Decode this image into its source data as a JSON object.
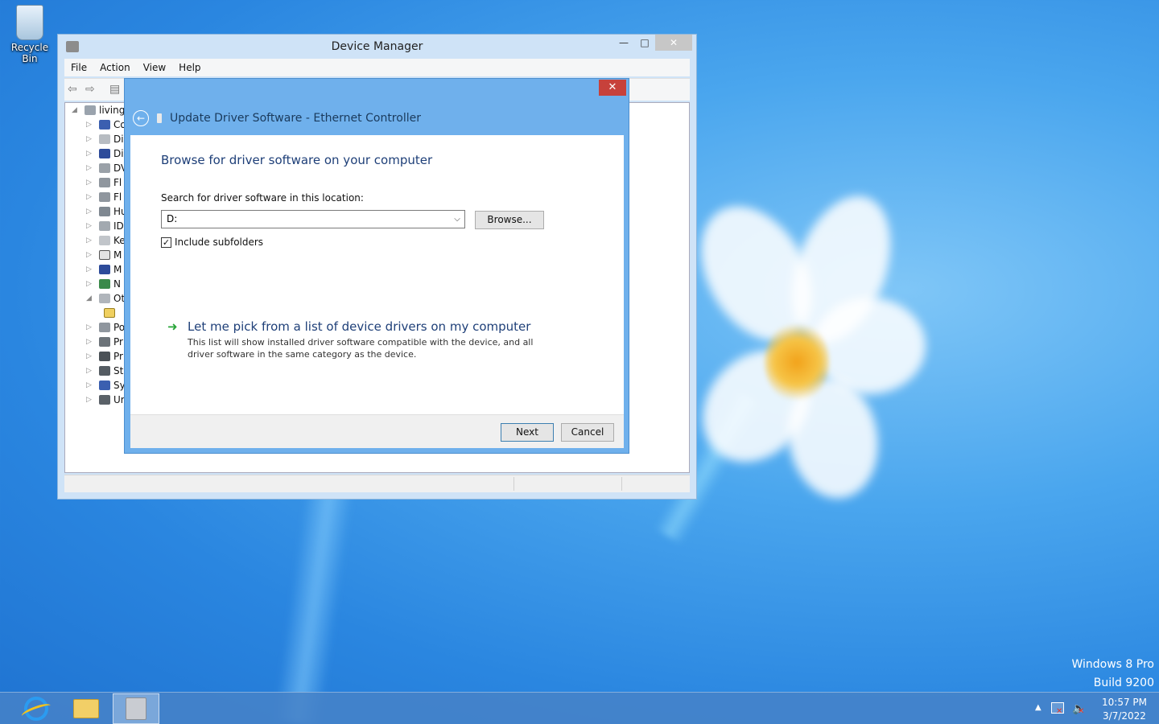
{
  "desktop": {
    "recycle_bin_label": "Recycle Bin",
    "watermark_line1": "Windows 8 Pro",
    "watermark_line2": "Build 9200"
  },
  "device_manager": {
    "title": "Device Manager",
    "menu": [
      "File",
      "Action",
      "View",
      "Help"
    ],
    "tree": {
      "root": "living",
      "items": [
        "Co",
        "Di",
        "Di",
        "DV",
        "Fl",
        "Fl",
        "Hu",
        "ID",
        "Ke",
        "M",
        "M",
        "N",
        "Ot",
        "",
        "Po",
        "Pr",
        "Pr",
        "St",
        "Sy",
        "Ur"
      ]
    }
  },
  "dialog": {
    "title": "Update Driver Software - Ethernet Controller",
    "heading": "Browse for driver software on your computer",
    "search_label": "Search for driver software in this location:",
    "path_value": "D:",
    "browse_label": "Browse...",
    "include_subfolders_label": "Include subfolders",
    "include_subfolders_checked": true,
    "pick_title": "Let me pick from a list of device drivers on my computer",
    "pick_description": "This list will show installed driver software compatible with the device, and all driver software in the same category as the device.",
    "next_label": "Next",
    "cancel_label": "Cancel"
  },
  "taskbar": {
    "time": "10:57 PM",
    "date": "3/7/2022"
  },
  "colors": {
    "dialog_frame": "#6fb0ec",
    "heading_blue": "#1e3f78",
    "close_red": "#c7413b",
    "arrow_green": "#2aa53a"
  }
}
